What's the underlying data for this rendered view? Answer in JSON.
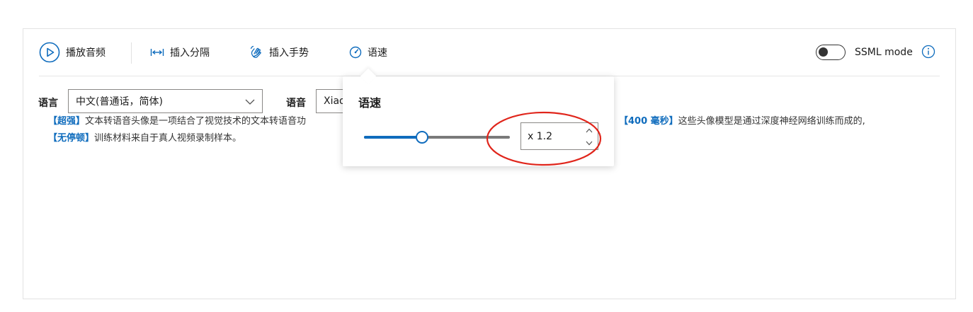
{
  "toolbar": {
    "play_label": "播放音频",
    "break_label": "插入分隔",
    "gesture_label": "插入手势",
    "rate_label": "语速",
    "ssml_label": "SSML mode"
  },
  "fields": {
    "language_label": "语言",
    "language_value": "中文(普通话，简体)",
    "voice_label": "语音",
    "voice_value": "Xiao"
  },
  "editor": {
    "line1": [
      {
        "tag": "【超强】",
        "text": "文本转语音头像是一项结合了视觉技术的文本转语音功"
      },
      {
        "tag": "【400 毫秒】",
        "text": "这些头像模型是通过深度神经网络训练而成的,"
      }
    ],
    "line2": [
      {
        "tag": "【无停顿】",
        "text": "训练材料来自于真人视频录制样本。"
      }
    ]
  },
  "rate_popover": {
    "title": "语速",
    "value_text": "x 1.2",
    "slider_fraction": 0.4
  },
  "colors": {
    "accent": "#0f6cbd",
    "annotation": "#e0251b"
  },
  "icons": [
    "play-circle-icon",
    "break-arrows-icon",
    "hand-wave-icon",
    "speed-gauge-icon",
    "info-icon",
    "chevron-down-icon",
    "spin-up-icon",
    "spin-down-icon"
  ]
}
